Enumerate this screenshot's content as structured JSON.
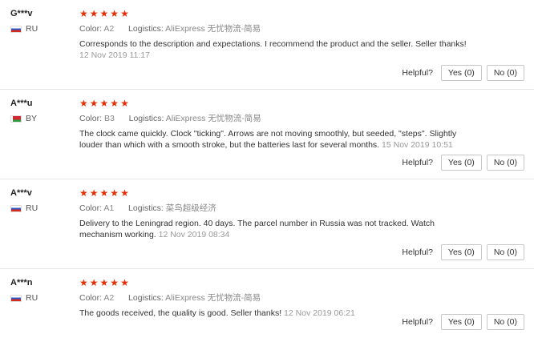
{
  "reviews": [
    {
      "buyer": "G***v",
      "country": "RU",
      "rating": 5,
      "color_label": "Color:",
      "color_value": "A2",
      "logistics_label": "Logistics:",
      "logistics_value": "AliExpress 无忧物流-简易",
      "text": "Corresponds to the description and expectations. I recommend the product and the seller. Seller thanks!",
      "date": "12 Nov 2019 11:17",
      "helpful_label": "Helpful?",
      "yes_label": "Yes (0)",
      "no_label": "No (0)"
    },
    {
      "buyer": "A***u",
      "country": "BY",
      "rating": 5,
      "color_label": "Color:",
      "color_value": "B3",
      "logistics_label": "Logistics:",
      "logistics_value": "AliExpress 无忧物流-简易",
      "text": "The clock came quickly. Clock \"ticking\". Arrows are not moving smoothly, but seeded, \"steps\". Slightly louder than which with a smooth stroke, but the batteries last for several months.",
      "date": "15 Nov 2019 10:51",
      "helpful_label": "Helpful?",
      "yes_label": "Yes (0)",
      "no_label": "No (0)"
    },
    {
      "buyer": "A***v",
      "country": "RU",
      "rating": 5,
      "color_label": "Color:",
      "color_value": "A1",
      "logistics_label": "Logistics:",
      "logistics_value": "菜鸟超级经济",
      "text": "Delivery to the Leningrad region. 40 days. The parcel number in Russia was not tracked. Watch mechanism working.",
      "date": "12 Nov 2019 08:34",
      "helpful_label": "Helpful?",
      "yes_label": "Yes (0)",
      "no_label": "No (0)"
    },
    {
      "buyer": "A***n",
      "country": "RU",
      "rating": 5,
      "color_label": "Color:",
      "color_value": "A2",
      "logistics_label": "Logistics:",
      "logistics_value": "AliExpress 无忧物流-简易",
      "text": "The goods received, the quality is good. Seller thanks!",
      "date": "12 Nov 2019 06:21",
      "helpful_label": "Helpful?",
      "yes_label": "Yes (0)",
      "no_label": "No (0)"
    }
  ],
  "colors": {
    "star": "#e62e04",
    "border": "#e6e6e6"
  },
  "icons": {
    "star": "star-icon",
    "flag_ru": "flag-ru-icon",
    "flag_by": "flag-by-icon"
  }
}
